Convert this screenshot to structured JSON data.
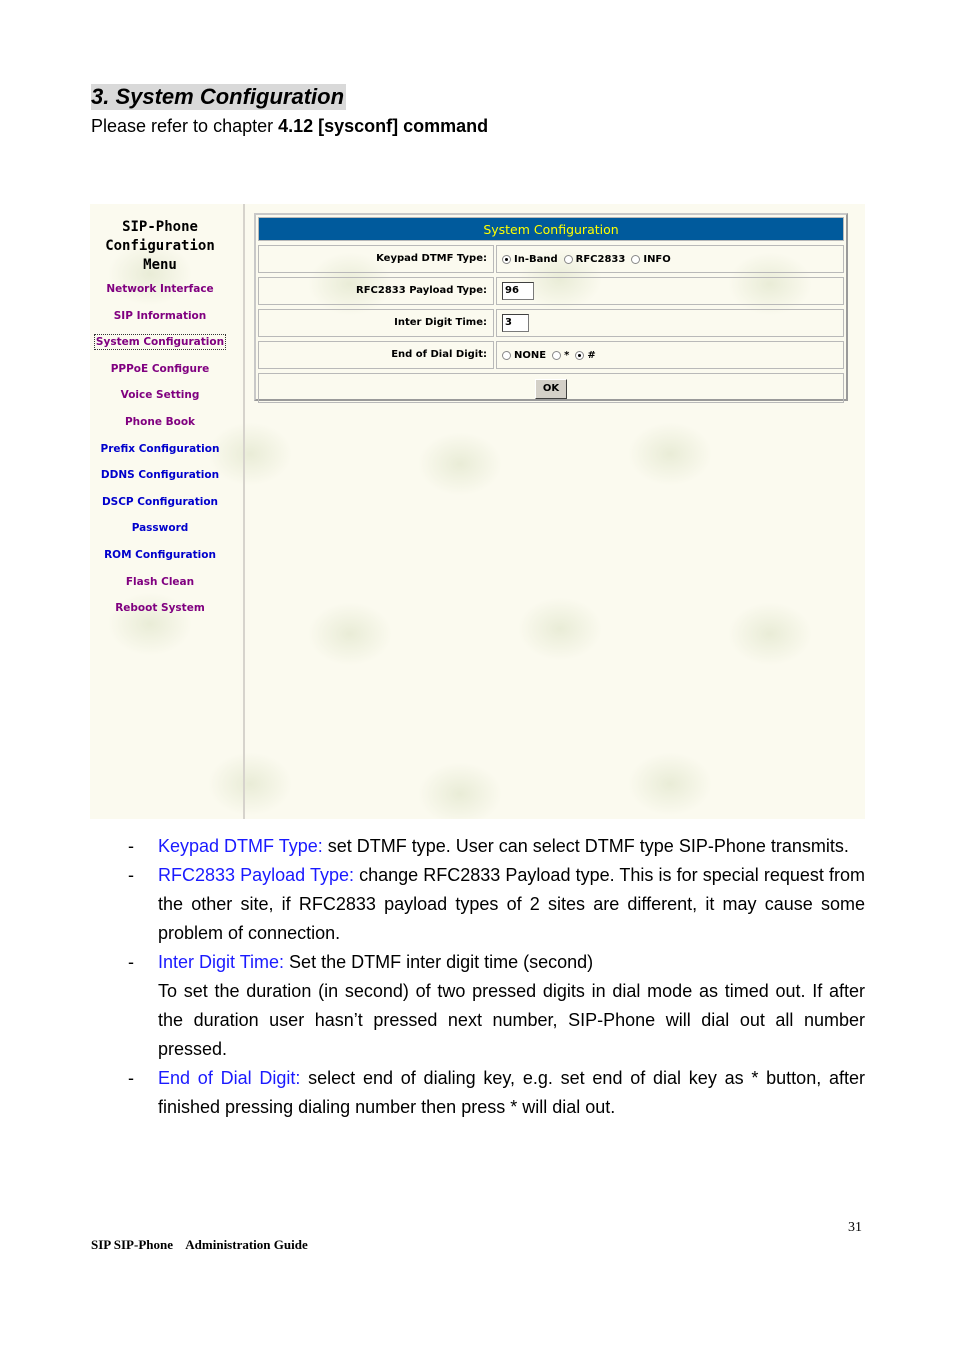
{
  "section": {
    "title": "3. System Configuration",
    "refer_prefix": "Please refer to chapter ",
    "refer_bold": "4.12 [sysconf] command"
  },
  "menu": {
    "title_lines": [
      "SIP-Phone",
      "Configuration",
      "Menu"
    ],
    "items": [
      {
        "label": "Network Interface",
        "state": "visited"
      },
      {
        "label": "SIP Information",
        "state": "visited"
      },
      {
        "label": "System Configuration",
        "state": "focused"
      },
      {
        "label": "PPPoE Configure",
        "state": "visited"
      },
      {
        "label": "Voice Setting",
        "state": "visited"
      },
      {
        "label": "Phone Book",
        "state": "visited"
      },
      {
        "label": "Prefix Configuration",
        "state": "unvisited"
      },
      {
        "label": "DDNS Configuration",
        "state": "unvisited"
      },
      {
        "label": "DSCP Configuration",
        "state": "unvisited"
      },
      {
        "label": "Password",
        "state": "unvisited"
      },
      {
        "label": "ROM Configuration",
        "state": "unvisited"
      },
      {
        "label": "Flash Clean",
        "state": "visited"
      },
      {
        "label": "Reboot System",
        "state": "visited"
      }
    ]
  },
  "config": {
    "header": "System Configuration",
    "header_bg": "#005a9c",
    "header_fg": "#ffff00",
    "keypad_dtmf": {
      "label": "Keypad DTMF Type:",
      "options": [
        {
          "label": "In-Band",
          "checked": true
        },
        {
          "label": "RFC2833",
          "checked": false
        },
        {
          "label": "INFO",
          "checked": false
        }
      ]
    },
    "rfc2833_payload": {
      "label": "RFC2833 Payload Type:",
      "value": "96"
    },
    "inter_digit": {
      "label": "Inter Digit Time:",
      "value": "3"
    },
    "end_of_dial": {
      "label": "End of Dial Digit:",
      "options": [
        {
          "label": "NONE",
          "checked": false
        },
        {
          "label": "*",
          "checked": false
        },
        {
          "label": "#",
          "checked": true
        }
      ]
    },
    "ok_label": "OK"
  },
  "descriptions": [
    {
      "term": "Keypad DTMF Type:",
      "text": " set DTMF type. User can select DTMF type SIP-Phone transmits."
    },
    {
      "term": "RFC2833 Payload Type:",
      "text": " change RFC2833 Payload type. This is for special request from the other site, if RFC2833 payload types of 2 sites are different, it may cause some problem of connection."
    },
    {
      "term": "Inter Digit Time:",
      "text": " Set the DTMF inter digit time (second)",
      "extra": "To set the duration (in second) of two pressed digits in dial mode as timed out. If after the duration user hasn’t pressed next number, SIP-Phone will dial out all number pressed."
    },
    {
      "term": "End of Dial Digit:",
      "text": " select end of dialing key, e.g. set end of dial key as * button, after finished pressing dialing number then press * will dial out."
    }
  ],
  "page_number": "31",
  "footer": "SIP SIP-Phone    Administration Guide"
}
